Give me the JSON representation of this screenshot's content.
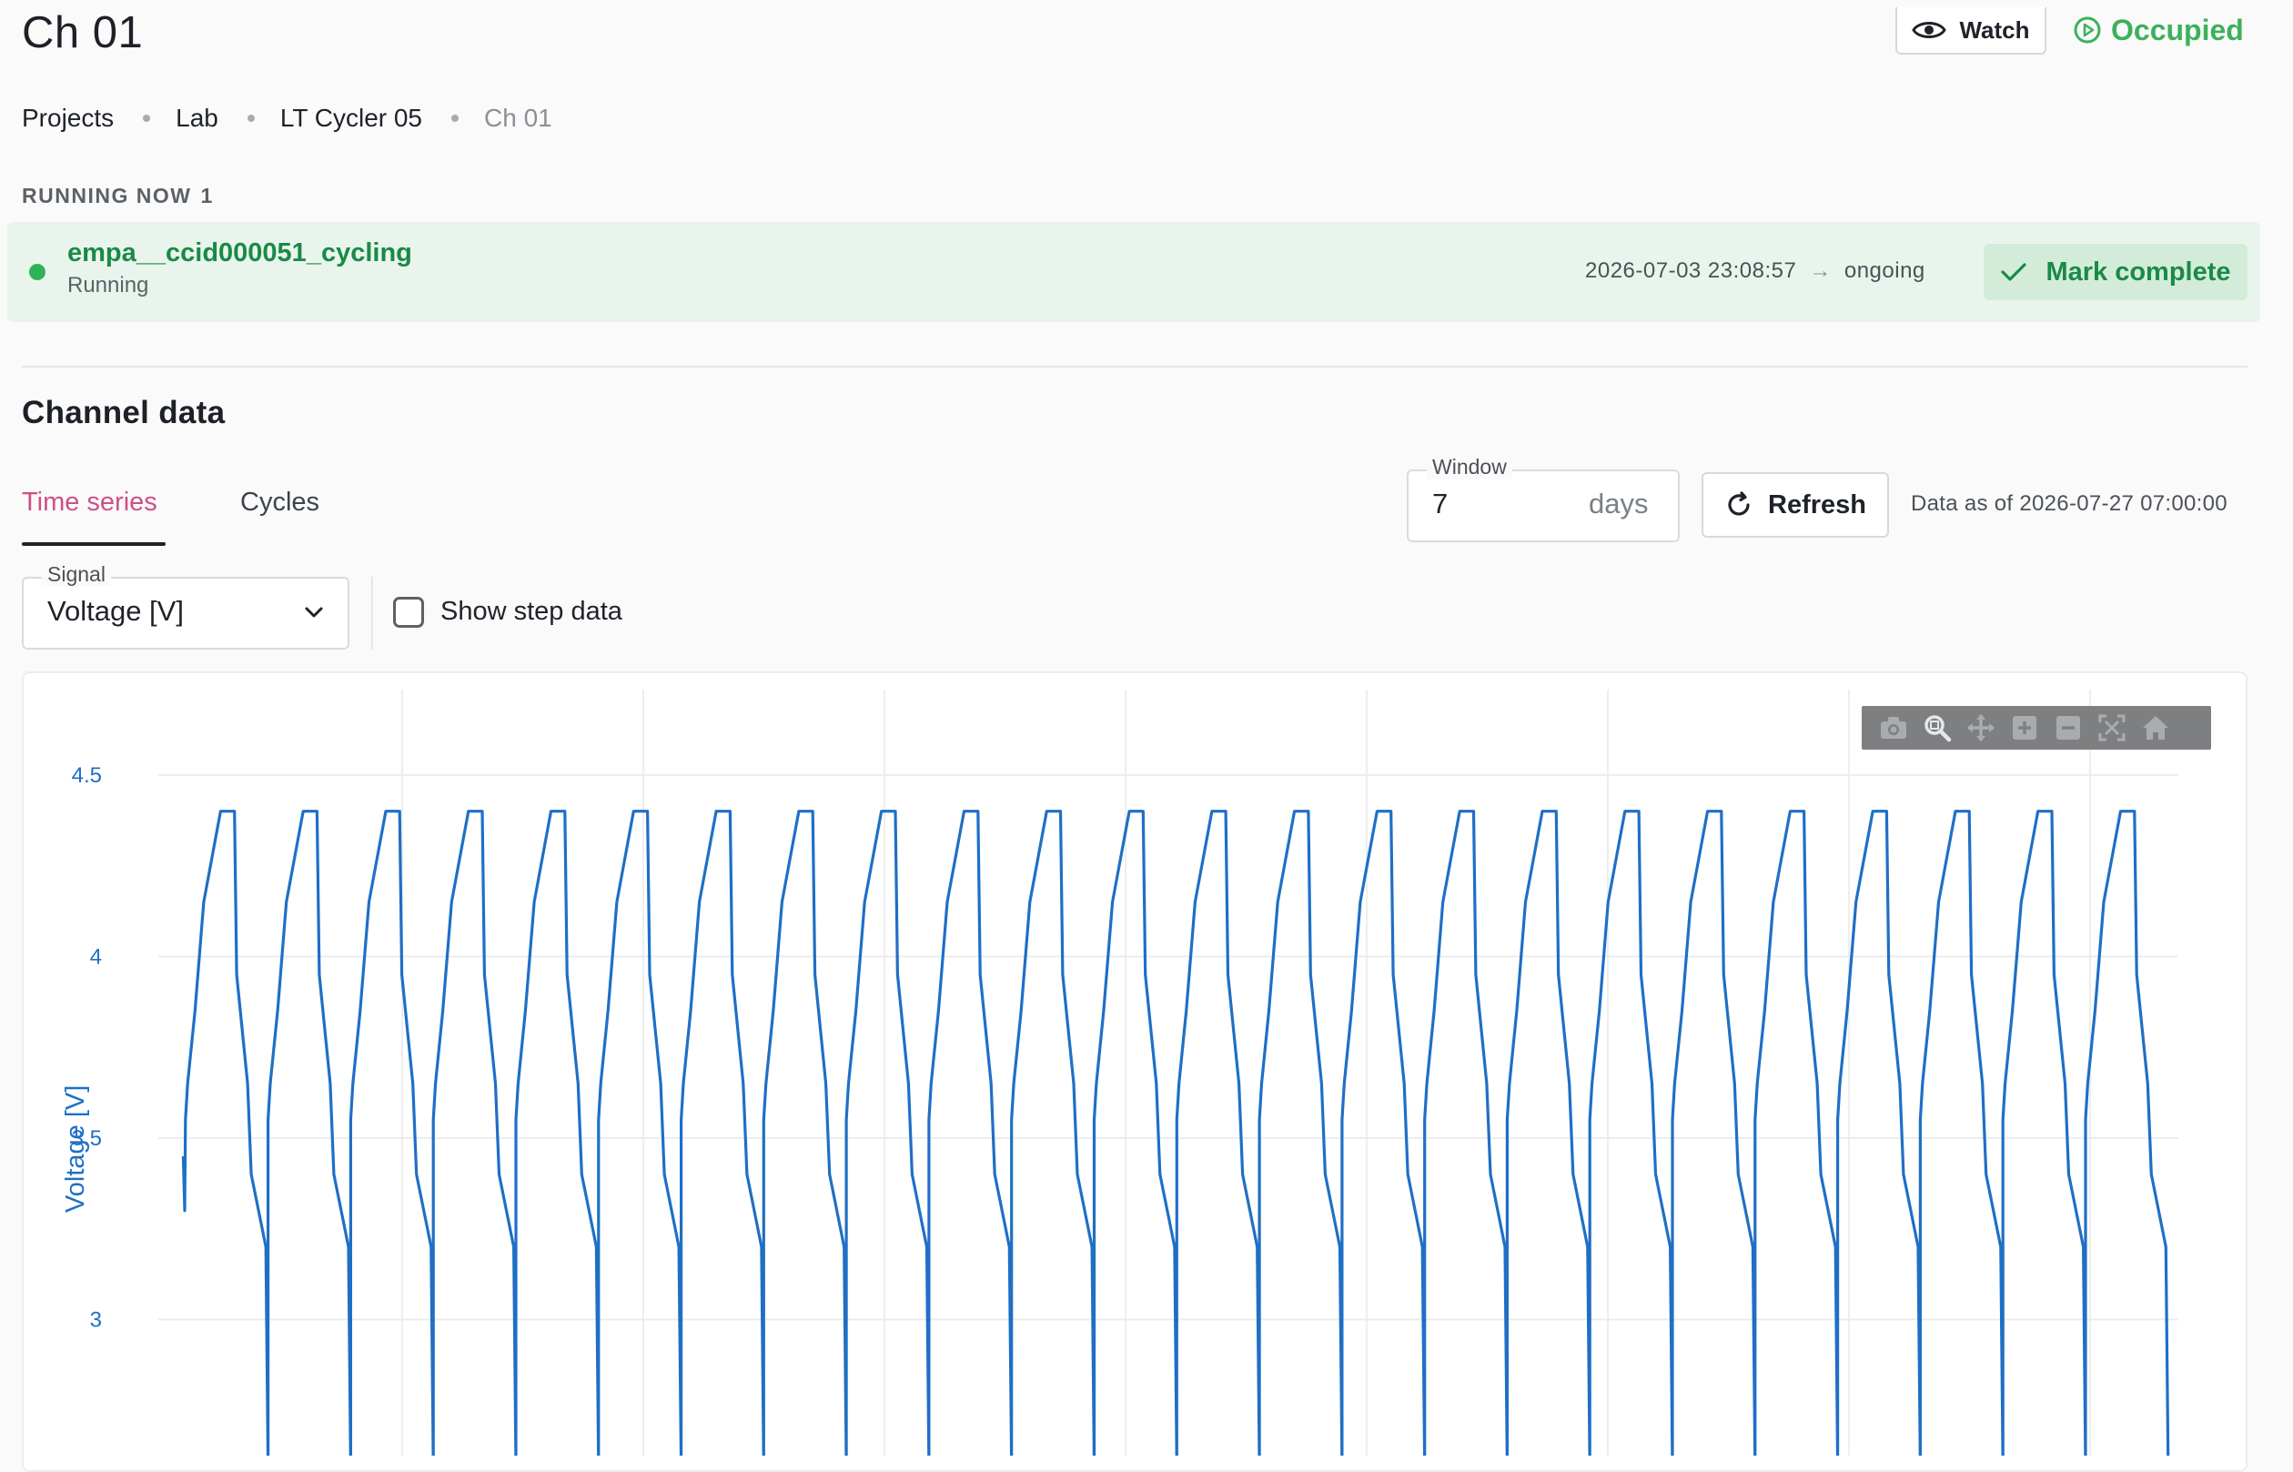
{
  "header": {
    "title": "Ch 01",
    "watch_label": "Watch",
    "status_label": "Occupied",
    "status_color": "#3cb15a"
  },
  "breadcrumb": {
    "items": [
      "Projects",
      "Lab",
      "LT Cycler 05",
      "Ch 01"
    ]
  },
  "running": {
    "heading": "RUNNING NOW",
    "count": "1",
    "job": {
      "name": "empa__ccid000051_cycling",
      "state": "Running",
      "start": "2026-07-03 23:08:57",
      "arrow": "→",
      "end": "ongoing",
      "mark_complete_label": "Mark complete"
    }
  },
  "channel": {
    "title": "Channel data",
    "tabs": [
      {
        "label": "Time series",
        "active": true
      },
      {
        "label": "Cycles",
        "active": false
      }
    ],
    "window": {
      "label": "Window",
      "value": "7",
      "unit": "days"
    },
    "refresh_label": "Refresh",
    "data_as_of": "Data as of 2026-07-27 07:00:00",
    "signal": {
      "label": "Signal",
      "value": "Voltage [V]"
    },
    "show_step_label": "Show step data",
    "show_step_checked": false,
    "accent_color": "#cf4f86"
  },
  "modebar": {
    "icons": [
      "camera-icon",
      "zoom-icon",
      "pan-icon",
      "zoom-in-icon",
      "zoom-out-icon",
      "autoscale-icon",
      "reset-axes-icon"
    ]
  },
  "chart_data": {
    "type": "line",
    "ylabel": "Voltage [V]",
    "y_ticks": [
      3,
      3.5,
      4,
      4.5
    ],
    "ylim": [
      2.58,
      4.66
    ],
    "series_color": "#1f6fc5",
    "grid": true,
    "cycle_period_hours": 11.3,
    "series": [
      {
        "name": "",
        "cycle_shape": {
          "hour_offsets": [
            0,
            0.3,
            1.3,
            2.5,
            4.8,
            6.7,
            7.0,
            8.5,
            9.0,
            11.0,
            11.3
          ],
          "voltages": [
            3.55,
            3.65,
            3.85,
            4.15,
            4.4,
            4.4,
            3.95,
            3.65,
            3.4,
            3.2,
            2.6
          ]
        },
        "cycles_visible": 24
      }
    ]
  }
}
